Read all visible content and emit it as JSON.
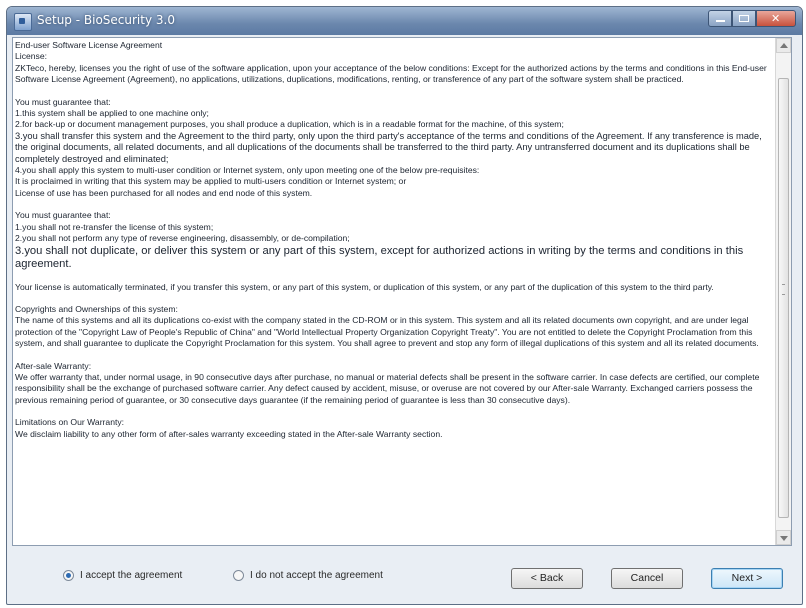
{
  "window": {
    "title": "Setup - BioSecurity 3.0"
  },
  "license": {
    "heading": "End-user Software License Agreement",
    "license_label": "License:",
    "intro": "ZKTeco, hereby, licenses you the right of use of the software application, upon your acceptance of the below conditions: Except for the authorized actions by the terms and conditions in this End-user Software License Agreement (Agreement), no applications, utilizations, duplications, modifications, renting, or transference of any part of the software system shall be practiced.",
    "guarantee1_title": "You must guarantee that:",
    "g1_item1": "1.this system shall be applied to one machine only;",
    "g1_item2": "2.for back-up or document management purposes, you shall produce a duplication, which is in a readable format for the machine, of this system;",
    "g1_item3": "3.you shall transfer this system and the Agreement to the third party, only upon the third party's acceptance of the terms and conditions of the Agreement. If any transference is made, the original documents, all related documents, and all duplications of the documents shall be transferred to the third party. Any untransferred document and its duplications shall be completely destroyed and eliminated;",
    "g1_item4": "4.you shall apply this system to multi-user condition or Internet system, only upon meeting one of the below pre-requisites:",
    "g1_item4a": "It is proclaimed in writing that this system may be applied to multi-users condition or Internet system; or",
    "g1_item4b": "License of use has been purchased for all nodes and end node of this system.",
    "guarantee2_title": "You must guarantee that:",
    "g2_item1": "1.you shall not re-transfer the license of this system;",
    "g2_item2": "2.you shall not perform any type of reverse engineering, disassembly, or de-compilation;",
    "g2_item3": "3.you shall not duplicate, or deliver this system or any part of this system, except for authorized actions in writing by the terms and conditions in this agreement.",
    "termination": "Your license is automatically terminated, if you transfer this system, or any part of this system, or duplication of this system, or any part of the duplication of this system to the third party.",
    "copyright_title": "Copyrights and Ownerships of this system:",
    "copyright_text": "The name of this systems and all its duplications co-exist with the company stated in the CD-ROM or in this system. This system and all its related documents own copyright, and are under legal protection of the \"Copyright Law of People's Republic of China\" and \"World Intellectual Property Organization Copyright Treaty\". You are not entitled to delete the Copyright Proclamation from this system, and shall guarantee to duplicate the Copyright Proclamation for this system. You shall agree to prevent and stop any form of illegal duplications of this system and all its related documents.",
    "warranty_title": "After-sale Warranty:",
    "warranty_text": "We offer warranty that, under normal usage, in 90 consecutive days after purchase, no manual or material defects shall be present in the software carrier. In case defects are certified, our complete responsibility shall be the exchange of purchased software carrier. Any defect caused by accident, misuse, or overuse are not covered by our After-sale Warranty. Exchanged carriers possess the previous remaining period of guarantee, or 30 consecutive days guarantee (if the remaining period of guarantee is less than 30 consecutive days).",
    "limitations_title": "Limitations on Our Warranty:",
    "limitations_text": "We disclaim liability to any other form of after-sales warranty exceeding stated in the After-sale Warranty section."
  },
  "options": {
    "accept_label": "I accept the agreement",
    "reject_label": "I do not accept the agreement",
    "selected": "accept"
  },
  "buttons": {
    "back": "< Back",
    "cancel": "Cancel",
    "next": "Next >"
  }
}
